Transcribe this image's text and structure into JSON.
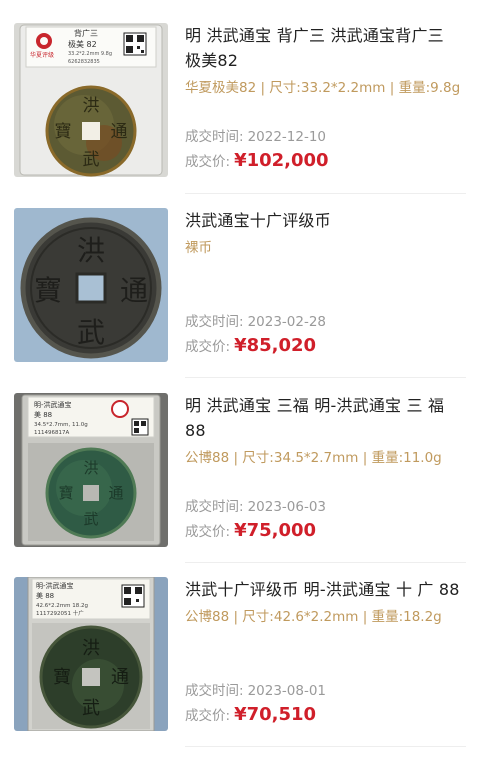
{
  "labels": {
    "time_label": "成交时间:",
    "price_label": "成交价:"
  },
  "items": [
    {
      "title": "明 洪武通宝 背广三 洪武通宝背广三 极美82",
      "spec": "华夏极美82 | 尺寸:33.2*2.2mm | 重量:9.8g",
      "time": "2022-12-10",
      "price": "¥102,000",
      "slab_label": "背广三",
      "slab_grade": "极美 82",
      "slab_brand": "华夏评级",
      "slab_line": "33.2*2.2mm 9.8g",
      "slab_cert": "6262832835"
    },
    {
      "title": "洪武通宝十广评级币",
      "spec": "裸币",
      "time": "2023-02-28",
      "price": "¥85,020"
    },
    {
      "title": "明 洪武通宝 三福 明-洪武通宝 三 福 88",
      "spec": "公博88 | 尺寸:34.5*2.7mm | 重量:11.0g",
      "time": "2023-06-03",
      "price": "¥75,000",
      "slab_label": "明-洪武通宝",
      "slab_grade": "美 88",
      "slab_line": "34.5*2.7mm, 11.0g",
      "slab_cert": "111496817A"
    },
    {
      "title": "洪武十广评级币 明-洪武通宝 十 广 88",
      "spec": "公博88 | 尺寸:42.6*2.2mm | 重量:18.2g",
      "time": "2023-08-01",
      "price": "¥70,510",
      "slab_label": "明-洪武通宝",
      "slab_grade": "美 88",
      "slab_line": "42.6*2.2mm 18.2g",
      "slab_cert": "1117292051 十广"
    }
  ],
  "coin_chars": {
    "top": "洪",
    "right": "通",
    "bottom": "武",
    "left": "寶"
  },
  "colors": {
    "price": "#d01f2a",
    "spec": "#c09a5e",
    "meta": "#9a9a9a",
    "title": "#222222"
  },
  "icons": [
    "qr-code-icon",
    "grading-logo-icon"
  ]
}
